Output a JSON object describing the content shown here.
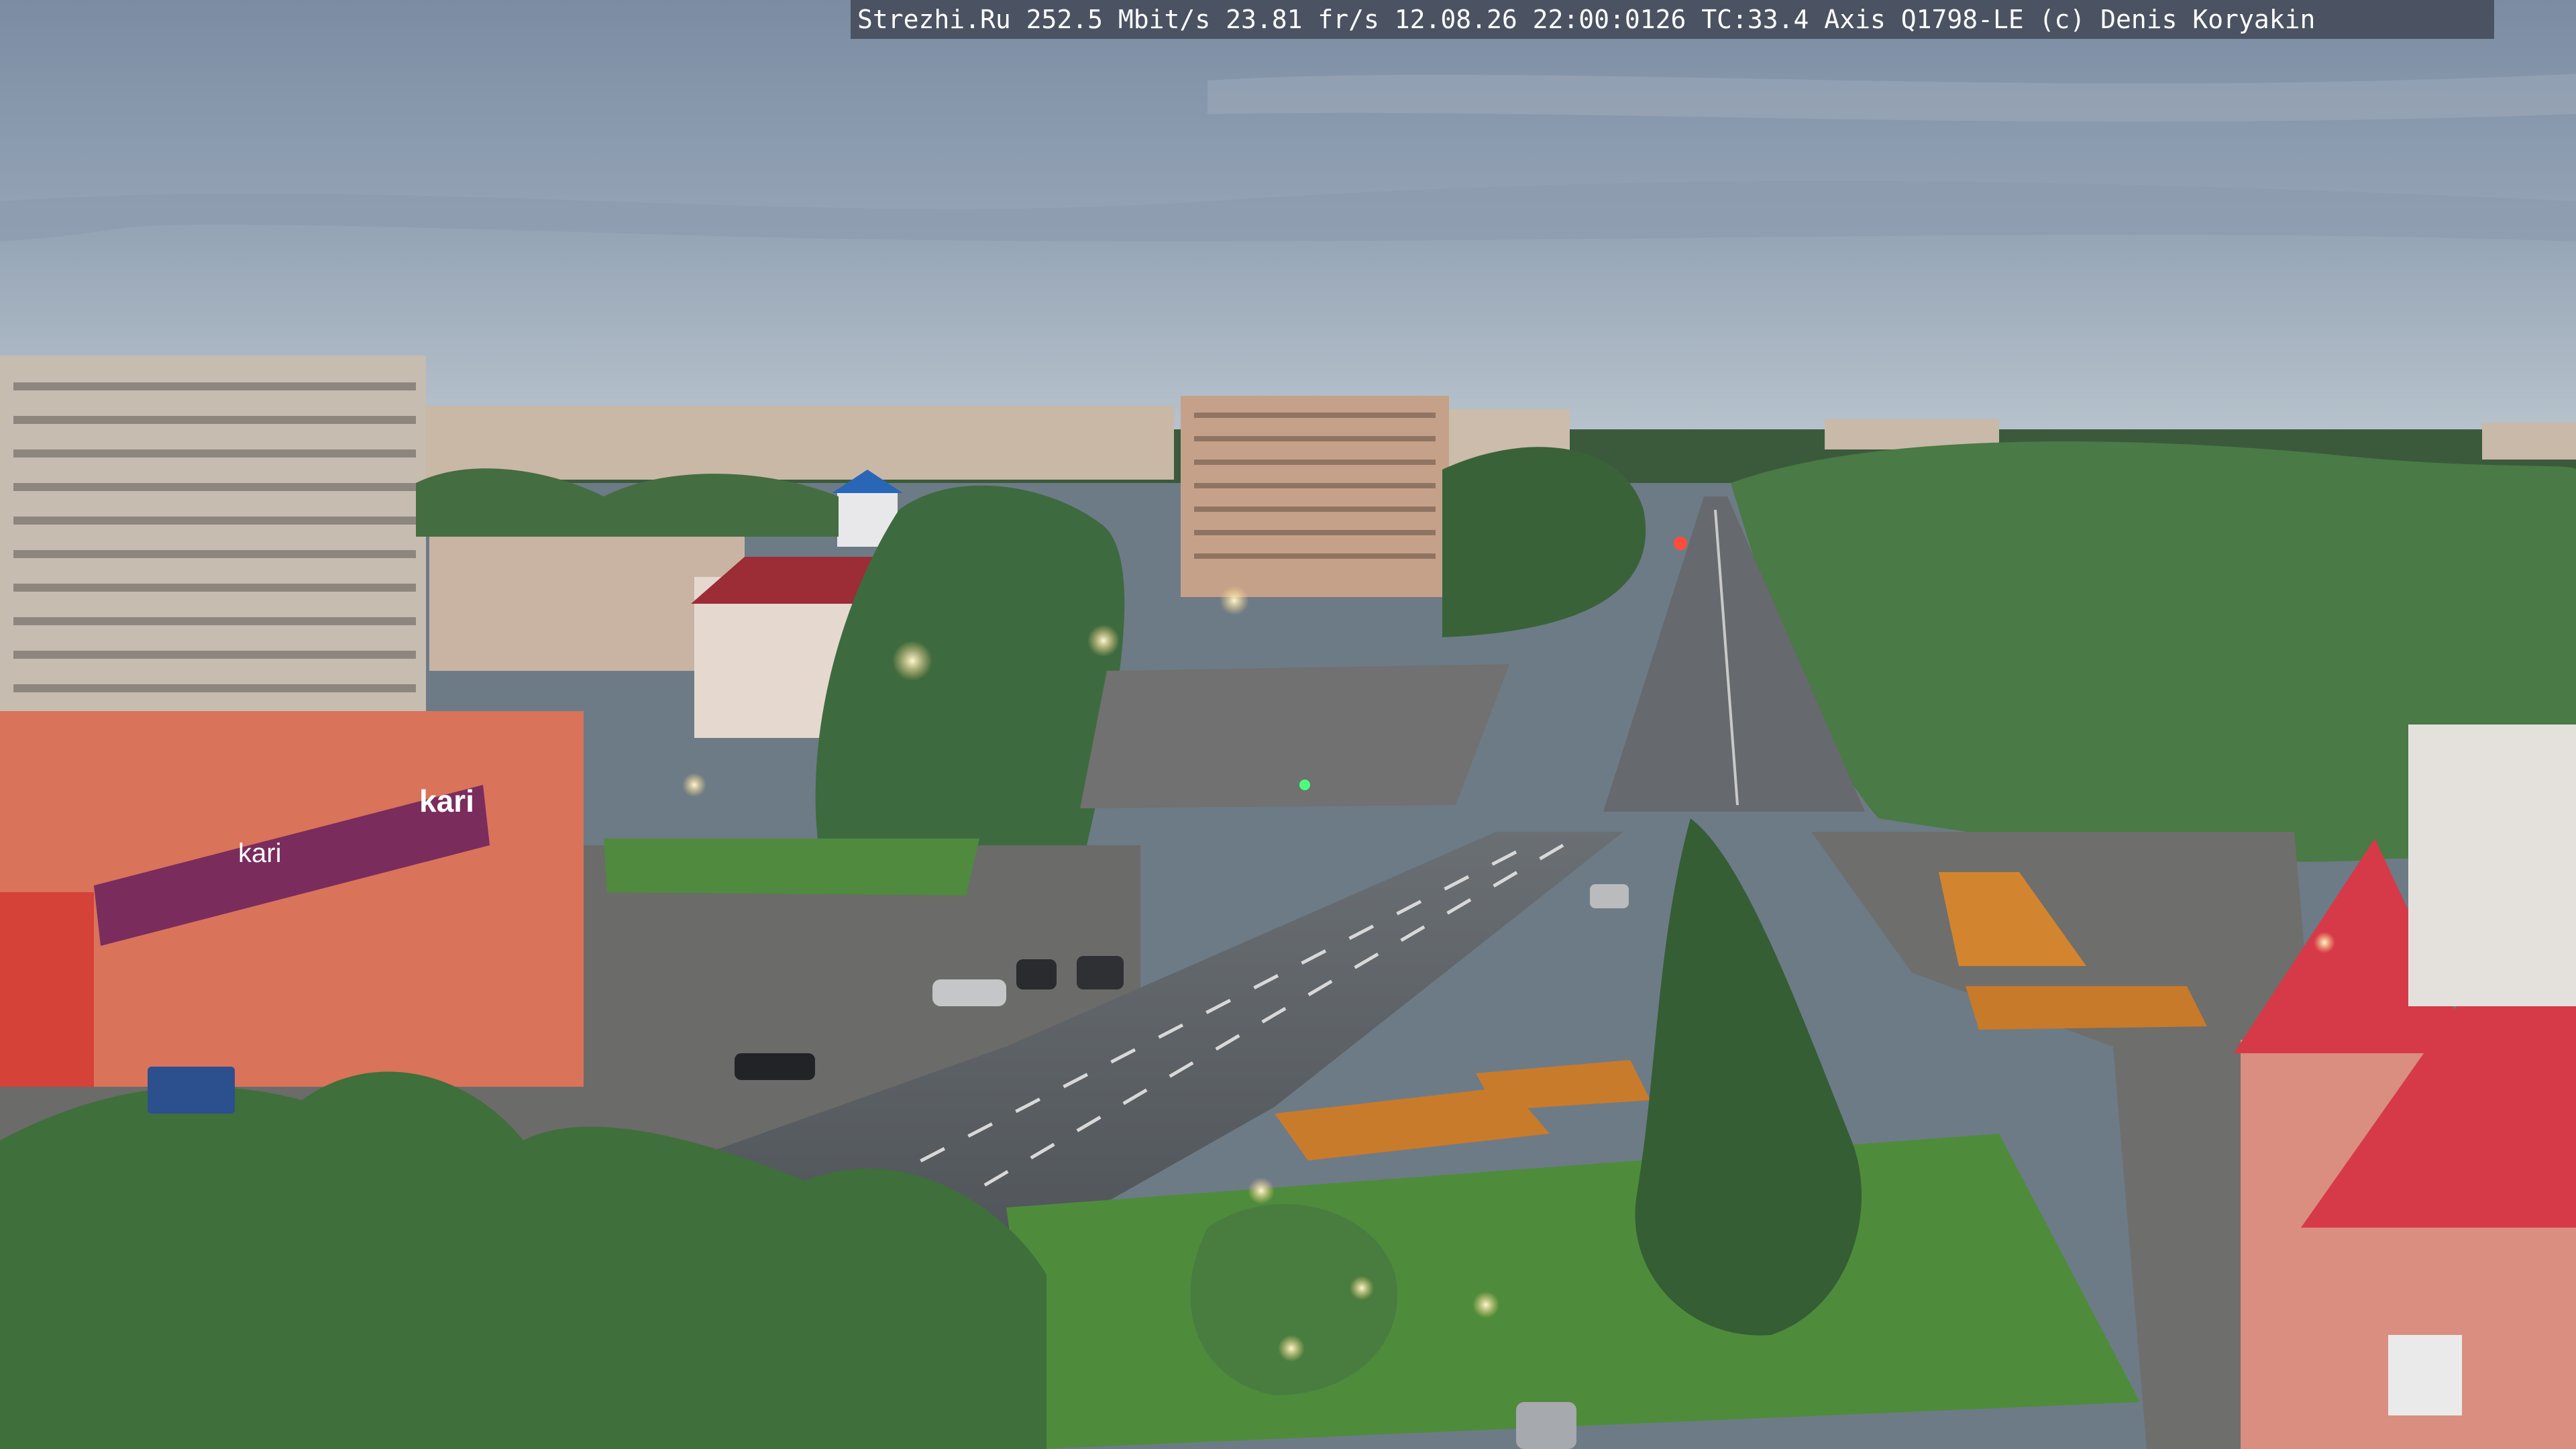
{
  "overlay": {
    "caption": "Strezhi.Ru 252.5 Mbit/s 23.81 fr/s 12.08.26 22:00:0126 TC:33.4  Axis Q1798-LE  (c) Denis Koryakin"
  },
  "scene": {
    "store_sign": "kari",
    "store_banner": "kari"
  },
  "colors": {
    "sky_top": "#7e8fa6",
    "sky_bottom": "#b6c1cb",
    "trees": "#3f6b3c",
    "road": "#5b5f63",
    "plaza": "#6e6e6c",
    "roof_red": "#c8323a",
    "store_banner": "#7a2c5c"
  }
}
